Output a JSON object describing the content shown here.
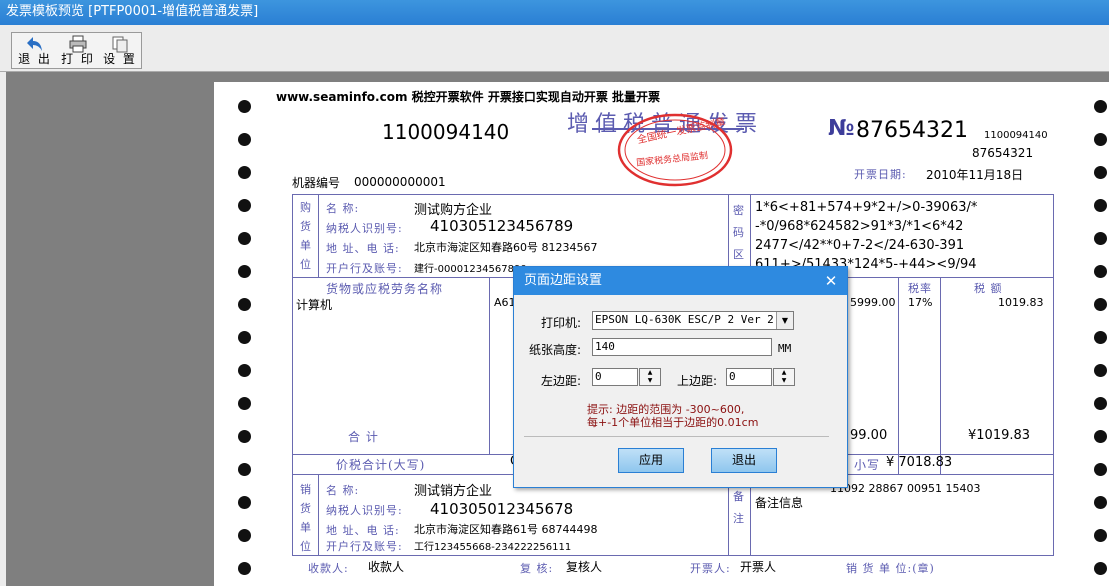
{
  "window": {
    "title": "发票模板预览 [PTFP0001-增值税普通发票]"
  },
  "toolbar": {
    "exit": "退 出",
    "print": "打 印",
    "settings": "设 置"
  },
  "invoice": {
    "header_ad": "www.seaminfo.com 税控开票软件 开票接口实现自动开票 批量开票",
    "code_left": "1100094140",
    "title": "增值税普通发票",
    "seal_top": "全国统一发票监制章",
    "seal_bottom": "国家税务总局监制",
    "no_prefix": "№",
    "number": "87654321",
    "code_right": "1100094140",
    "number_right": "87654321",
    "date_label": "开票日期:",
    "date": "2010年11月18日",
    "machine_label": "机器编号",
    "machine_no": "000000000001",
    "buyer": {
      "side_label": "购货单位",
      "name_label": "名 称:",
      "name": "测试购方企业",
      "tax_label": "纳税人识别号:",
      "tax_id": "410305123456789",
      "addr_label": "地 址、电 话:",
      "addr": "北京市海淀区知春路60号 81234567",
      "bank_label": "开户行及账号:",
      "bank": "建行-00001234567890"
    },
    "cipher": {
      "side_label": "密码区",
      "lines": [
        "1*6<+81+574+9*2+/>0-39063/*",
        "-*0/968*624582>91*3/*1<6*42",
        "2477</42**0+7-2</24-630-391",
        "611+>/51433*124*5-+44><9/94"
      ]
    },
    "items_header": {
      "name": "货物或应税劳务名称",
      "tax_rate": "税率",
      "tax": "税 额"
    },
    "item": {
      "name": "计算机",
      "spec_partial": "A61",
      "amount_partial": "5999.00",
      "rate": "17%",
      "tax": "1019.83"
    },
    "total": {
      "label": "合 计",
      "amount_partial": "99.00",
      "tax": "¥1019.83"
    },
    "grand": {
      "label": "价税合计(大写)",
      "partial": "C",
      "small_label": "小写",
      "small": "¥ 7018.83"
    },
    "seller": {
      "side_label": "销货单位",
      "name_label": "名 称:",
      "name": "测试销方企业",
      "tax_label": "纳税人识别号:",
      "tax_id": "410305012345678",
      "addr_label": "地 址、电 话:",
      "addr": "北京市海淀区知春路61号 68744498",
      "bank_label": "开户行及账号:",
      "bank": "工行123455668-234222256111"
    },
    "remark": {
      "side_label": "备注",
      "line1": "11092 28867 00951 15403",
      "line2": "备注信息"
    },
    "footer": {
      "payee_label": "收款人:",
      "payee": "收款人",
      "reviewer_label": "复 核:",
      "reviewer": "复核人",
      "drawer_label": "开票人:",
      "drawer": "开票人",
      "seller_label": "销 货 单 位:(章)"
    }
  },
  "dialog": {
    "title": "页面边距设置",
    "close": "✕",
    "printer_label": "打印机:",
    "printer": "EPSON LQ-630K ESC/P 2 Ver 2.0",
    "height_label": "纸张高度:",
    "height": "140",
    "unit": "MM",
    "left_label": "左边距:",
    "left": "0",
    "top_label": "上边距:",
    "top": "0",
    "hint1": "提示: 边距的范围为 -300~600,",
    "hint2": "每+-1个单位相当于边距的0.01cm",
    "apply": "应用",
    "exit": "退出"
  },
  "colors": {
    "accent": "#2e8ae0",
    "invoice_ink": "#5b5bb0",
    "seal": "#e03030",
    "hint": "#8b1010"
  }
}
